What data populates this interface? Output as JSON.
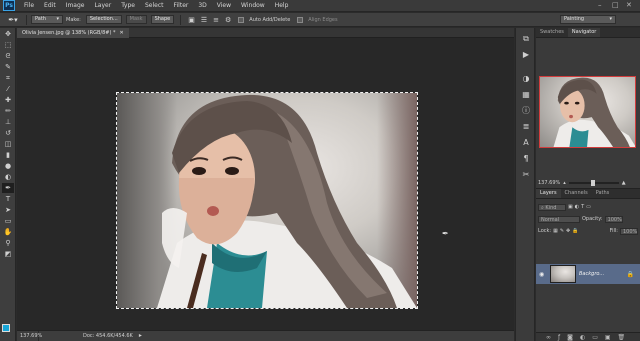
{
  "app": {
    "logo": "Ps"
  },
  "menu": [
    "File",
    "Edit",
    "Image",
    "Layer",
    "Type",
    "Select",
    "Filter",
    "3D",
    "View",
    "Window",
    "Help"
  ],
  "options": {
    "mode": "Path",
    "make_label": "Make:",
    "selection_button": "Selection...",
    "mask_button": "Mask",
    "shape_button": "Shape",
    "auto_add_delete": "Auto Add/Delete",
    "align_edges": "Align Edges",
    "workspace": "Painting"
  },
  "document": {
    "tab_title": "Olivia Jensen.jpg @ 138% (RGB/8#) *",
    "zoom": "137.69%",
    "doc_info": "Doc: 454.6K/454.6K"
  },
  "panels": {
    "top_tabs": [
      "Swatches",
      "Navigator"
    ],
    "navigator_zoom": "137.69%",
    "layers_tabs": [
      "Layers",
      "Channels",
      "Paths"
    ],
    "kind_label": "Kind",
    "blend_mode": "Normal",
    "opacity_label": "Opacity:",
    "opacity_value": "100%",
    "lock_label": "Lock:",
    "fill_label": "Fill:",
    "fill_value": "100%",
    "layer_name": "Backgro..."
  },
  "colors": {
    "foreground": "#17a6d8",
    "background": "#ffffff",
    "selected_layer": "#596b8a",
    "navigator_frame": "#d23c3c"
  }
}
